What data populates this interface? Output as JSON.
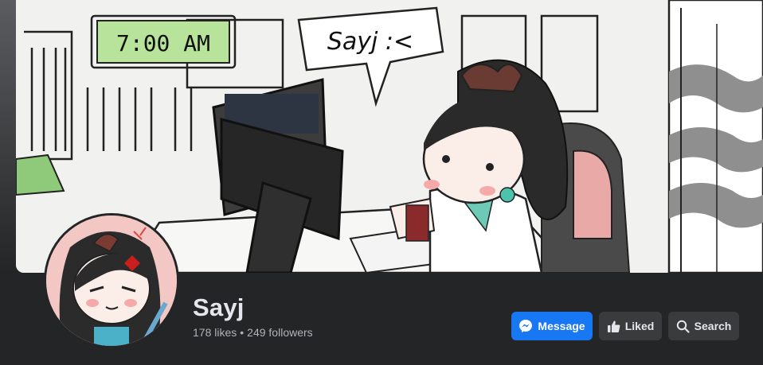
{
  "cover": {
    "clock_text": "7:00 AM",
    "speech_text": "Sayj :<"
  },
  "profile": {
    "name": "Sayj",
    "likes": "178 likes",
    "separator": "•",
    "followers": "249 followers"
  },
  "actions": {
    "message_label": "Message",
    "liked_label": "Liked",
    "search_label": "Search"
  },
  "colors": {
    "primary": "#1877f2",
    "background": "#242526",
    "button": "#3a3b3c",
    "text": "#e4e6eb",
    "secondary_text": "#b0b3b8"
  },
  "icons": [
    "messenger-icon",
    "thumbs-up-icon",
    "search-icon"
  ]
}
